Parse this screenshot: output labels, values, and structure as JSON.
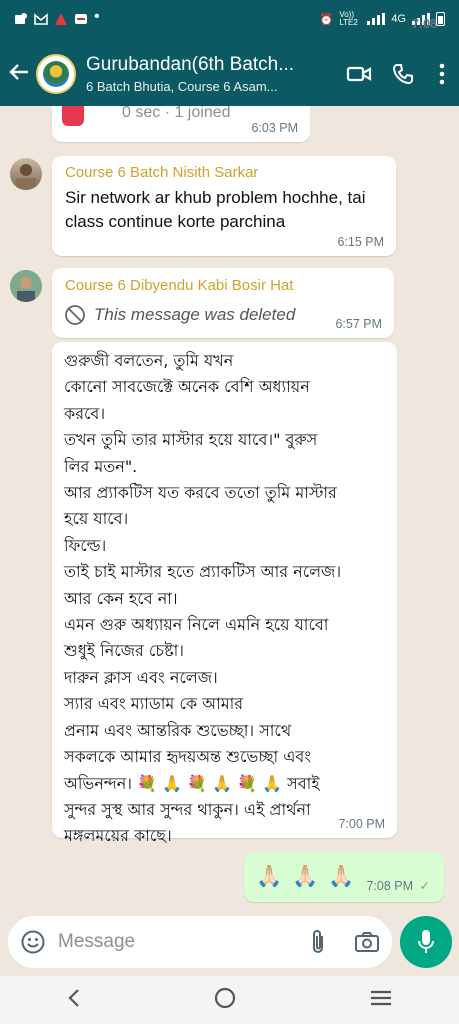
{
  "status_bar": {
    "time": "7:08",
    "network": "Vo)) LTE2",
    "signal": "4G"
  },
  "header": {
    "title": "Gurubandan(6th Batch...",
    "subtitle": "6 Batch Bhutia, Course 6 Asam..."
  },
  "messages": [
    {
      "type": "call-log",
      "text": "0 sec · 1 joined",
      "time": "6:03 PM"
    },
    {
      "type": "incoming",
      "sender": "Course 6 Batch Nisith Sarkar",
      "text": "Sir network ar khub problem hochhe, tai class continue korte parchina",
      "time": "6:15 PM"
    },
    {
      "type": "incoming-deleted",
      "sender": "Course 6 Dibyendu Kabi Bosir Hat",
      "text": "This message was deleted",
      "time": "6:57 PM"
    },
    {
      "type": "incoming",
      "lines": [
        "গুরুজী বলতেন, তুমি যখন",
        "কোনো সাবজেক্টে অনেক বেশি অধ্যায়ন",
        "করবে।",
        "তখন তুমি তার মাস্টার হয়ে যাবে।\" বুরুস",
        "লির মতন\".",
        "আর প্র্যাকটিস যত করবে ততো তুমি মাস্টার",
        "হয়ে যাবে।",
        "ফিল্ডে।",
        "তাই চাই মাস্টার হতে প্র্যাকটিস আর নলেজ।",
        "আর কেন হবে না।",
        "এমন গুরু অধ্যায়ন নিলে এমনি হয়ে যাবো",
        "শুধুই নিজের চেষ্টা।",
        "দারুন ক্লাস এবং নলেজ।",
        "স্যার এবং ম্যাডাম কে আমার",
        "প্রনাম এবং আন্তরিক শুভেচ্ছা। সাথে",
        "সকলকে আমার হৃদয়অন্ত শুভেচ্ছা এবং",
        "অভিনন্দন। 💐 🙏 💐 🙏 💐 🙏  সবাই",
        "সুন্দর সুস্থ আর সুন্দর থাকুন। এই প্রার্থনা",
        "মঙ্গলময়ের কাছে।"
      ],
      "time": "7:00 PM"
    },
    {
      "type": "outgoing",
      "text": "🙏🏻 🙏🏻 🙏🏻",
      "time": "7:08 PM",
      "status": "✓"
    }
  ],
  "composer": {
    "placeholder": "Message"
  },
  "colors": {
    "header": "#0b5a63",
    "chat_bg": "#efe7dd",
    "sender_name": "#d4a02a",
    "outgoing_bubble": "#d9fdd3",
    "mic_button": "#00a884"
  }
}
